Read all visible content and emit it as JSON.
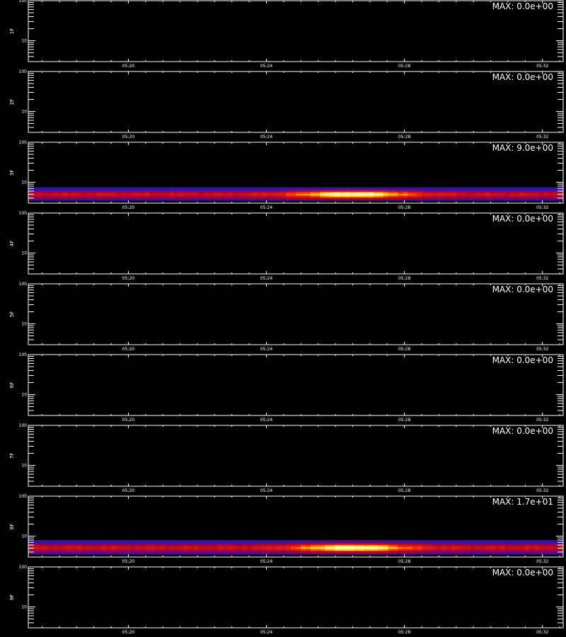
{
  "chart_data": {
    "type": "heatmap",
    "y_scale": "log",
    "y_ticks": [
      10,
      100
    ],
    "x_tick_labels": [
      "05:20",
      "05:24",
      "05:28",
      "05:32"
    ],
    "panels": [
      {
        "ylabel": "1F",
        "max_label": "MAX: 0.0e+00",
        "max": 0.0,
        "band": null
      },
      {
        "ylabel": "2F",
        "max_label": "MAX: 0.0e+00",
        "max": 0.0,
        "band": null
      },
      {
        "ylabel": "3F",
        "max_label": "MAX: 9.0e+00",
        "max": 9.0,
        "band": {
          "y_low": 3.5,
          "y_high": 7.5,
          "peak_start": "05:25",
          "peak_end": "05:28"
        }
      },
      {
        "ylabel": "4F",
        "max_label": "MAX: 0.0e+00",
        "max": 0.0,
        "band": null
      },
      {
        "ylabel": "5F",
        "max_label": "MAX: 0.0e+00",
        "max": 0.0,
        "band": null
      },
      {
        "ylabel": "6F",
        "max_label": "MAX: 0.0e+00",
        "max": 0.0,
        "band": null
      },
      {
        "ylabel": "7F",
        "max_label": "MAX: 0.0e+00",
        "max": 0.0,
        "band": null
      },
      {
        "ylabel": "8F",
        "max_label": "MAX: 1.7e+01",
        "max": 17.0,
        "band": {
          "y_low": 3.5,
          "y_high": 8.0,
          "peak_start": "05:25",
          "peak_end": "05:28"
        }
      },
      {
        "ylabel": "9F",
        "max_label": "MAX: 0.0e+00",
        "max": 0.0,
        "band": null
      }
    ],
    "colors": {
      "background": "#000000",
      "axes": "#ffffff",
      "low": "#1010ff",
      "mid": "#d01010",
      "high": "#ffffa0"
    }
  }
}
